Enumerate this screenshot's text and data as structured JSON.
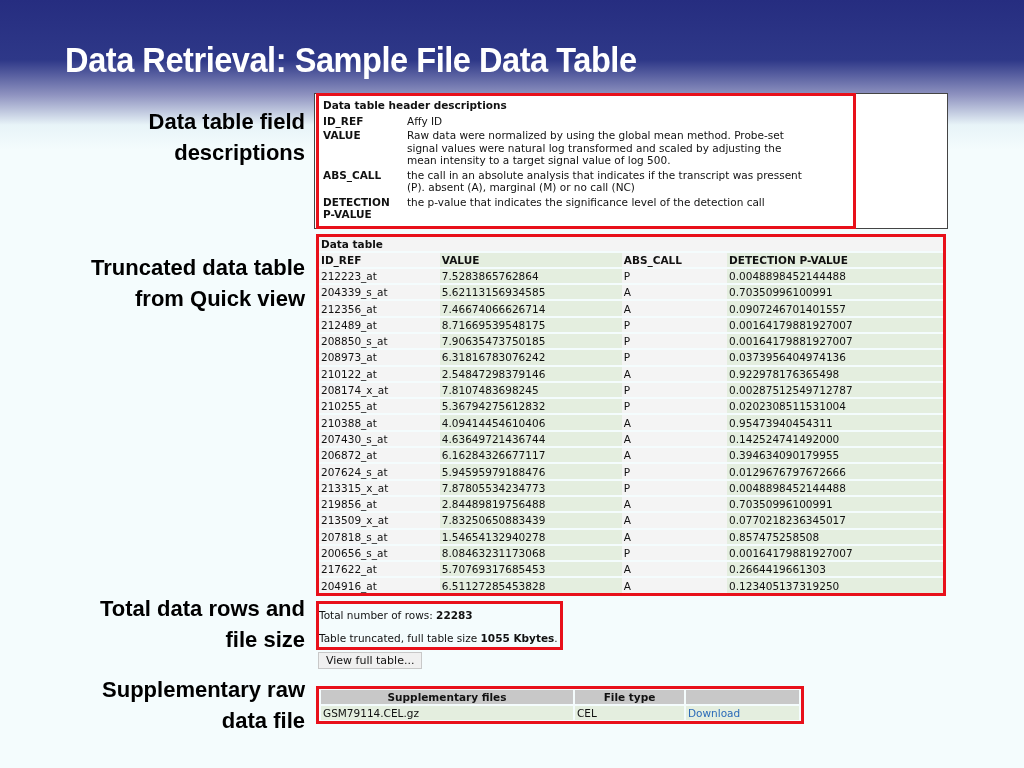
{
  "slide": {
    "title": "Data Retrieval: Sample File Data Table"
  },
  "callouts": [
    "Data table field descriptions",
    "Truncated data table from Quick view",
    "Total data rows and file size",
    "Supplementary raw data file"
  ],
  "descriptions": {
    "title": "Data table header descriptions",
    "items": [
      {
        "field": "ID_REF",
        "text": "Affy ID"
      },
      {
        "field": "VALUE",
        "text": "Raw data were normalized by using the global mean method. Probe-set signal values were natural log transformed and scaled by adjusting the mean intensity to a target signal value of log 500."
      },
      {
        "field": "ABS_CALL",
        "text": "the call in an absolute analysis that indicates if the transcript was pressent (P). absent (A), marginal (M) or no call (NC)"
      },
      {
        "field": "DETECTION P-VALUE",
        "text": "the p-value that indicates the significance level of the detection call"
      }
    ]
  },
  "data_table": {
    "title": "Data table",
    "columns": [
      "ID_REF",
      "VALUE",
      "ABS_CALL",
      "DETECTION P-VALUE"
    ],
    "rows": [
      [
        "212223_at",
        "7.5283865762864",
        "P",
        "0.0048898452144488"
      ],
      [
        "204339_s_at",
        "5.62113156934585",
        "A",
        "0.70350996100991"
      ],
      [
        "212356_at",
        "7.46674066626714",
        "A",
        "0.0907246701401557"
      ],
      [
        "212489_at",
        "8.71669539548175",
        "P",
        "0.00164179881927007"
      ],
      [
        "208850_s_at",
        "7.90635473750185",
        "P",
        "0.00164179881927007"
      ],
      [
        "208973_at",
        "6.31816783076242",
        "P",
        "0.0373956404974136"
      ],
      [
        "210122_at",
        "2.54847298379146",
        "A",
        "0.922978176365498"
      ],
      [
        "208174_x_at",
        "7.8107483698245",
        "P",
        "0.00287512549712787"
      ],
      [
        "210255_at",
        "5.36794275612832",
        "P",
        "0.0202308511531004"
      ],
      [
        "210388_at",
        "4.09414454610406",
        "A",
        "0.95473940454311"
      ],
      [
        "207430_s_at",
        "4.63649721436744",
        "A",
        "0.142524741492000"
      ],
      [
        "206872_at",
        "6.16284326677117",
        "A",
        "0.394634090179955"
      ],
      [
        "207624_s_at",
        "5.94595979188476",
        "P",
        "0.0129676797672666"
      ],
      [
        "213315_x_at",
        "7.87805534234773",
        "P",
        "0.0048898452144488"
      ],
      [
        "219856_at",
        "2.84489819756488",
        "A",
        "0.70350996100991"
      ],
      [
        "213509_x_at",
        "7.83250650883439",
        "A",
        "0.0770218236345017"
      ],
      [
        "207818_s_at",
        "1.54654132940278",
        "A",
        "0.857475258508"
      ],
      [
        "200656_s_at",
        "8.08463231173068",
        "P",
        "0.00164179881927007"
      ],
      [
        "217622_at",
        "5.70769317685453",
        "A",
        "0.2664419661303"
      ],
      [
        "204916_at",
        "6.51127285453828",
        "A",
        "0.123405137319250"
      ]
    ]
  },
  "summary": {
    "rows_text": "Total number of rows: **22283**",
    "size_text": "Table truncated, full table size **1055 Kbytes**."
  },
  "view_button": {
    "label": "View full table..."
  },
  "supplementary": {
    "columns": [
      "Supplementary files",
      "File type"
    ],
    "rows": [
      {
        "file": "GSM79114.CEL.gz",
        "type": "CEL",
        "link": "Download"
      }
    ]
  }
}
